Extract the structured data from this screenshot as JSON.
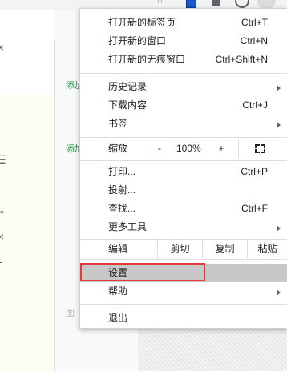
{
  "background": {
    "links": [
      "添加",
      "添加"
    ],
    "faint_text": "图"
  },
  "menu": {
    "items_top": [
      {
        "label": "打开新的标签页",
        "shortcut": "Ctrl+T"
      },
      {
        "label": "打开新的窗口",
        "shortcut": "Ctrl+N"
      },
      {
        "label": "打开新的无痕窗口",
        "shortcut": "Ctrl+Shift+N"
      }
    ],
    "items_mid": [
      {
        "label": "历史记录",
        "shortcut": ""
      },
      {
        "label": "下载内容",
        "shortcut": "Ctrl+J"
      },
      {
        "label": "书签",
        "shortcut": ""
      }
    ],
    "zoom": {
      "label": "缩放",
      "minus": "-",
      "value": "100%",
      "plus": "+"
    },
    "items_tools": [
      {
        "label": "打印...",
        "shortcut": "Ctrl+P"
      },
      {
        "label": "投射...",
        "shortcut": ""
      },
      {
        "label": "查找...",
        "shortcut": "Ctrl+F"
      },
      {
        "label": "更多工具",
        "shortcut": ""
      }
    ],
    "edit": {
      "label": "编辑",
      "cut": "剪切",
      "copy": "复制",
      "paste": "粘贴"
    },
    "settings": {
      "label": "设置"
    },
    "help": {
      "label": "帮助"
    },
    "exit": {
      "label": "退出"
    },
    "highlight_color": "#e53935"
  }
}
